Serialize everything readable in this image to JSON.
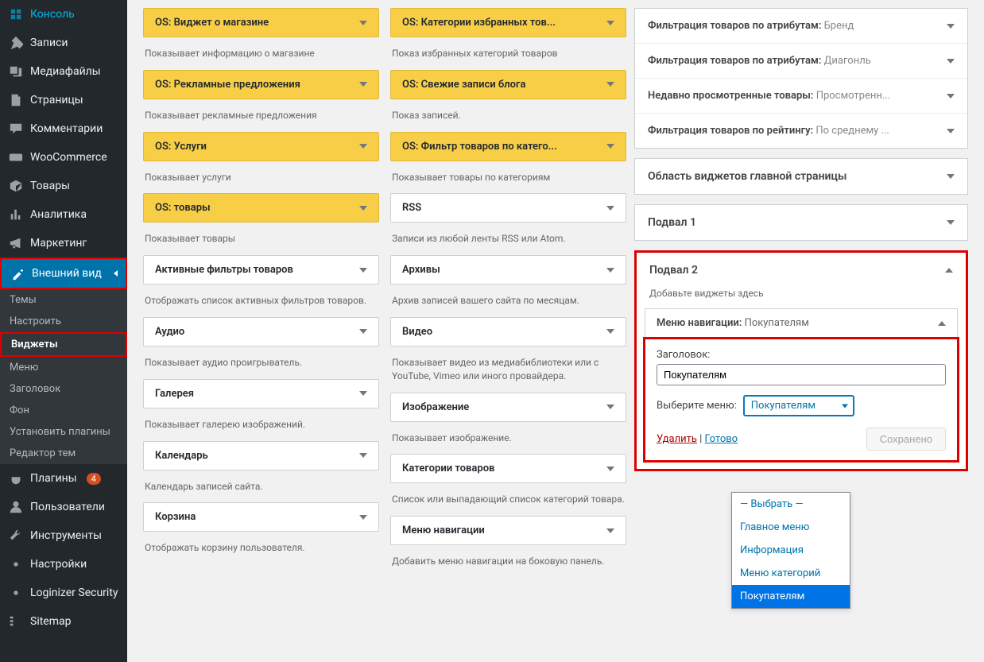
{
  "sidebar": {
    "items": [
      {
        "label": "Консоль",
        "icon": "dashboard"
      },
      {
        "label": "Записи",
        "icon": "pin"
      },
      {
        "label": "Медиафайлы",
        "icon": "media"
      },
      {
        "label": "Страницы",
        "icon": "pages"
      },
      {
        "label": "Комментарии",
        "icon": "comment"
      },
      {
        "label": "WooCommerce",
        "icon": "woo"
      },
      {
        "label": "Товары",
        "icon": "product"
      },
      {
        "label": "Аналитика",
        "icon": "analytics"
      },
      {
        "label": "Маркетинг",
        "icon": "marketing"
      },
      {
        "label": "Внешний вид",
        "icon": "appearance",
        "active": true
      },
      {
        "label": "Плагины",
        "icon": "plugins",
        "badge": "4"
      },
      {
        "label": "Пользователи",
        "icon": "users"
      },
      {
        "label": "Инструменты",
        "icon": "tools"
      },
      {
        "label": "Настройки",
        "icon": "settings"
      },
      {
        "label": "Loginizer Security",
        "icon": "security"
      },
      {
        "label": "Sitemap",
        "icon": "sitemap"
      }
    ],
    "sub": [
      {
        "label": "Темы"
      },
      {
        "label": "Настроить"
      },
      {
        "label": "Виджеты",
        "current": true
      },
      {
        "label": "Меню"
      },
      {
        "label": "Заголовок"
      },
      {
        "label": "Фон"
      },
      {
        "label": "Установить плагины"
      },
      {
        "label": "Редактор тем"
      }
    ]
  },
  "widgets_left": [
    {
      "title": "OS: Виджет о магазине",
      "desc": "Показывает информацию о магазине",
      "yellow": true
    },
    {
      "title": "OS: Рекламные предложения",
      "desc": "Показывает рекламные предложения",
      "yellow": true
    },
    {
      "title": "OS: Услуги",
      "desc": "Показывает услуги",
      "yellow": true
    },
    {
      "title": "OS: товары",
      "desc": "Показывает товары",
      "yellow": true
    },
    {
      "title": "Активные фильтры товаров",
      "desc": "Отображать список активных фильтров товаров."
    },
    {
      "title": "Аудио",
      "desc": "Показывает аудио проигрыватель."
    },
    {
      "title": "Галерея",
      "desc": "Показывает галерею изображений."
    },
    {
      "title": "Календарь",
      "desc": "Календарь записей сайта."
    },
    {
      "title": "Корзина",
      "desc": "Отображать корзину пользователя."
    }
  ],
  "widgets_right": [
    {
      "title": "OS: Категории избранных тов...",
      "desc": "Показ избранных категорий товаров",
      "yellow": true
    },
    {
      "title": "OS: Свежие записи блога",
      "desc": "Показ записей.",
      "yellow": true
    },
    {
      "title": "OS: Фильтр товаров по катего...",
      "desc": "Показывает товары по категориям",
      "yellow": true
    },
    {
      "title": "RSS",
      "desc": "Записи из любой ленты RSS или Atom."
    },
    {
      "title": "Архивы",
      "desc": "Архив записей вашего сайта по месяцам."
    },
    {
      "title": "Видео",
      "desc": "Показывает видео из медиабиблиотеки или с YouTube, Vimeo или иного провайдера."
    },
    {
      "title": "Изображение",
      "desc": "Показывает изображение."
    },
    {
      "title": "Категории товаров",
      "desc": "Список или выпадающий список категорий товара."
    },
    {
      "title": "Меню навигации",
      "desc": "Добавить меню навигации на боковую панель."
    }
  ],
  "areas": {
    "filters": [
      {
        "label": "Фильтрация товаров по атрибутам:",
        "value": "Бренд"
      },
      {
        "label": "Фильтрация товаров по атрибутам:",
        "value": "Диагонль"
      },
      {
        "label": "Недавно просмотренные товары:",
        "value": "Просмотренн..."
      },
      {
        "label": "Фильтрация товаров по рейтингу:",
        "value": "По среднему ..."
      }
    ],
    "main_area": "Область виджетов главной страницы",
    "footer1": "Подвал 1",
    "footer2": {
      "title": "Подвал 2",
      "subtitle": "Добавьте виджеты здесь",
      "widget": {
        "name": "Меню навигации:",
        "value": "Покупателям",
        "field_label": "Заголовок:",
        "field_value": "Покупателям",
        "select_label": "Выберите меню:",
        "select_value": "Покупателям",
        "delete": "Удалить",
        "done": "Готово",
        "saved": "Сохранено"
      }
    }
  },
  "dropdown": {
    "options": [
      "— Выбрать —",
      "Главное меню",
      "Информация",
      "Меню категорий",
      "Покупателям"
    ],
    "selected": "Покупателям"
  },
  "separator": " | "
}
